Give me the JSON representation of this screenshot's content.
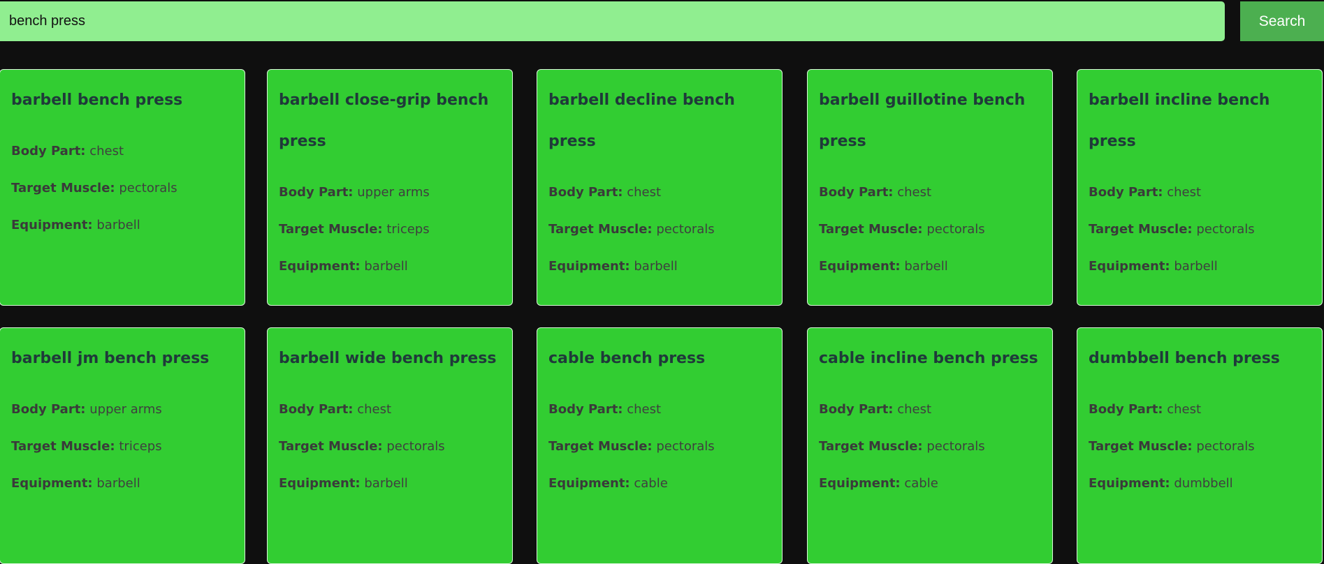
{
  "search": {
    "value": "bench press",
    "button_label": "Search"
  },
  "labels": {
    "body_part": "Body Part:",
    "target_muscle": "Target Muscle:",
    "equipment": "Equipment:"
  },
  "cards": [
    {
      "name": "barbell bench press",
      "body_part": "chest",
      "target": "pectorals",
      "equipment": "barbell"
    },
    {
      "name": "barbell close-grip bench press",
      "body_part": "upper arms",
      "target": "triceps",
      "equipment": "barbell"
    },
    {
      "name": "barbell decline bench press",
      "body_part": "chest",
      "target": "pectorals",
      "equipment": "barbell"
    },
    {
      "name": "barbell guillotine bench press",
      "body_part": "chest",
      "target": "pectorals",
      "equipment": "barbell"
    },
    {
      "name": "barbell incline bench press",
      "body_part": "chest",
      "target": "pectorals",
      "equipment": "barbell"
    },
    {
      "name": "barbell jm bench press",
      "body_part": "upper arms",
      "target": "triceps",
      "equipment": "barbell"
    },
    {
      "name": "barbell wide bench press",
      "body_part": "chest",
      "target": "pectorals",
      "equipment": "barbell"
    },
    {
      "name": "cable bench press",
      "body_part": "chest",
      "target": "pectorals",
      "equipment": "cable"
    },
    {
      "name": "cable incline bench press",
      "body_part": "chest",
      "target": "pectorals",
      "equipment": "cable"
    },
    {
      "name": "dumbbell bench press",
      "body_part": "chest",
      "target": "pectorals",
      "equipment": "dumbbell"
    }
  ],
  "colors": {
    "page_background": "#0f0f0f",
    "search_input_background": "#90ee90",
    "search_button_background": "#4caf50",
    "card_background": "#32cd32"
  }
}
